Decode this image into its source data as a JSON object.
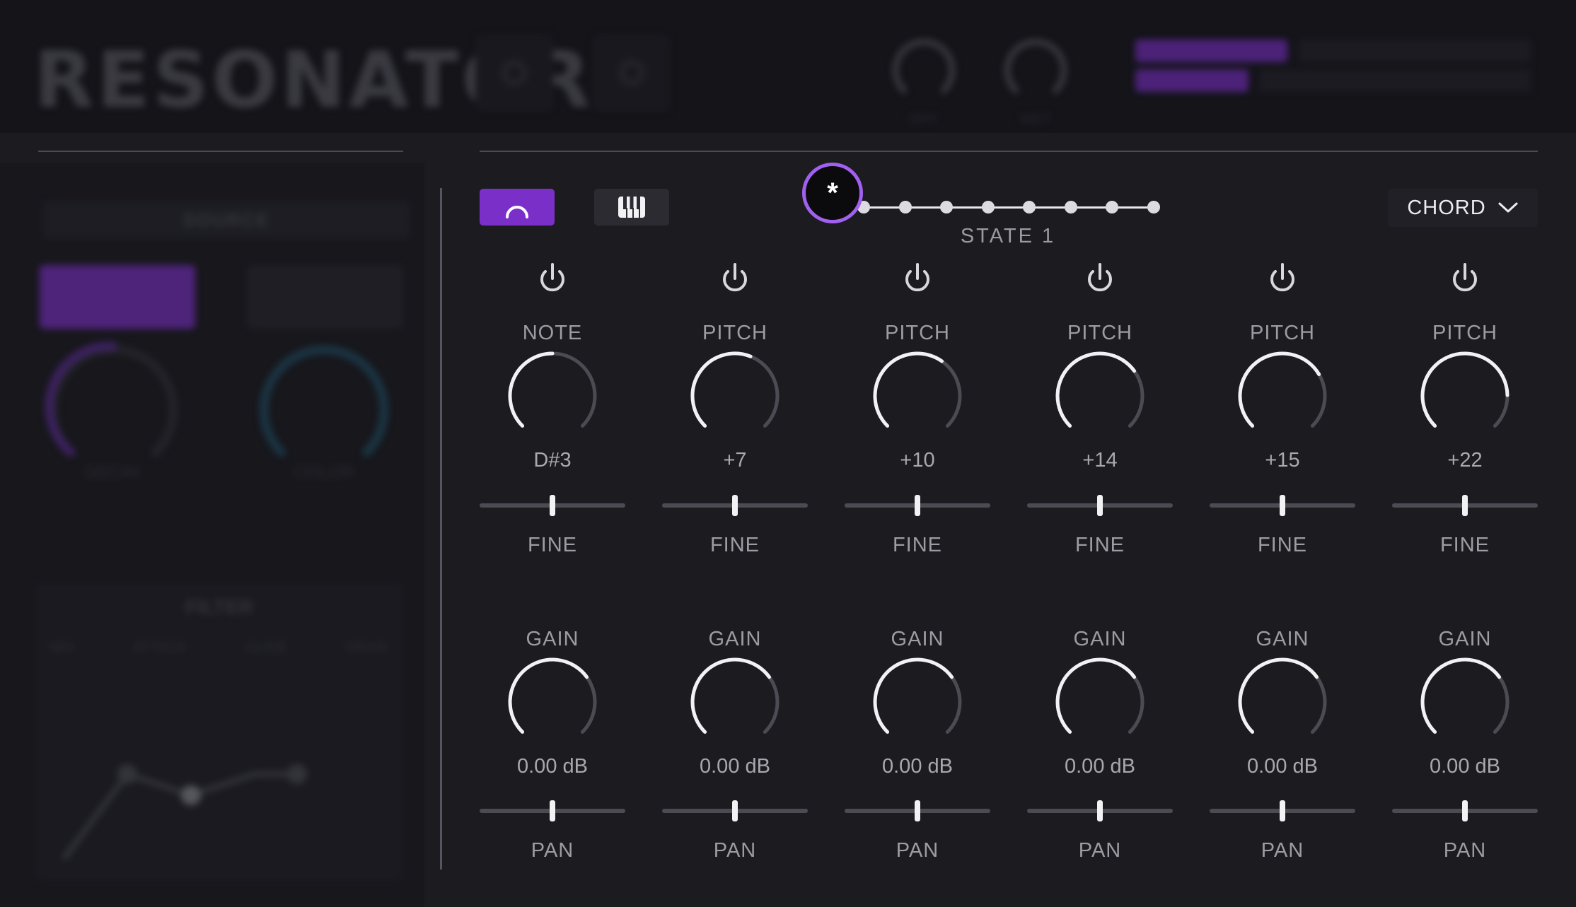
{
  "header": {
    "logo": "RESONATOR",
    "knobs": [
      {
        "label": "DRY"
      },
      {
        "label": "WET"
      }
    ]
  },
  "left_panel": {
    "section_label": "SOURCE",
    "knobs": [
      {
        "label": "DECAY"
      },
      {
        "label": "COLOR"
      }
    ],
    "filter": {
      "title": "FILTER",
      "tabs": [
        "MIX",
        "ATTACK",
        "GLIDE",
        "DRIVE"
      ]
    }
  },
  "mode_toggle": {
    "resonator_icon": "arc-icon",
    "keys_icon": "piano-keys-icon"
  },
  "state": {
    "marker": "*",
    "label": "STATE 1",
    "count": 8,
    "selected": 1
  },
  "chord_select": {
    "value": "CHORD"
  },
  "channels": [
    {
      "top_label": "NOTE",
      "top_value": "D#3",
      "top_fraction": 0.5,
      "fine_label": "FINE",
      "gain_label": "GAIN",
      "gain_value": "0.00 dB",
      "gain_fraction": 0.7,
      "pan_label": "PAN",
      "fine_fraction": 0.5,
      "pan_fraction": 0.5
    },
    {
      "top_label": "PITCH",
      "top_value": "+7",
      "top_fraction": 0.58,
      "fine_label": "FINE",
      "gain_label": "GAIN",
      "gain_value": "0.00 dB",
      "gain_fraction": 0.7,
      "pan_label": "PAN",
      "fine_fraction": 0.5,
      "pan_fraction": 0.5
    },
    {
      "top_label": "PITCH",
      "top_value": "+10",
      "top_fraction": 0.63,
      "fine_label": "FINE",
      "gain_label": "GAIN",
      "gain_value": "0.00 dB",
      "gain_fraction": 0.7,
      "pan_label": "PAN",
      "fine_fraction": 0.5,
      "pan_fraction": 0.5
    },
    {
      "top_label": "PITCH",
      "top_value": "+14",
      "top_fraction": 0.7,
      "fine_label": "FINE",
      "gain_label": "GAIN",
      "gain_value": "0.00 dB",
      "gain_fraction": 0.7,
      "pan_label": "PAN",
      "fine_fraction": 0.5,
      "pan_fraction": 0.5
    },
    {
      "top_label": "PITCH",
      "top_value": "+15",
      "top_fraction": 0.72,
      "fine_label": "FINE",
      "gain_label": "GAIN",
      "gain_value": "0.00 dB",
      "gain_fraction": 0.7,
      "pan_label": "PAN",
      "fine_fraction": 0.5,
      "pan_fraction": 0.5
    },
    {
      "top_label": "PITCH",
      "top_value": "+22",
      "top_fraction": 0.83,
      "fine_label": "FINE",
      "gain_label": "GAIN",
      "gain_value": "0.00 dB",
      "gain_fraction": 0.7,
      "pan_label": "PAN",
      "fine_fraction": 0.5,
      "pan_fraction": 0.5
    }
  ],
  "colors": {
    "accent": "#7b2fc9",
    "accent_ring": "#a160f0",
    "knob_active": "#f2f2f5",
    "knob_track": "#4b4b53"
  }
}
